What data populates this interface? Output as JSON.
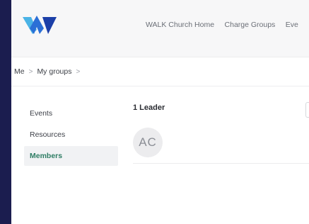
{
  "colors": {
    "background": "#1b1d4f",
    "accent": "#2e7d64",
    "logo_light": "#4ab3e6",
    "logo_dark": "#1c3fa8"
  },
  "logo": {
    "icon": "walk-church-logo"
  },
  "nav": {
    "items": [
      "WALK Church Home",
      "Charge Groups",
      "Eve"
    ]
  },
  "breadcrumb": {
    "items": [
      "Me",
      "My groups"
    ],
    "separator": ">"
  },
  "sidebar": {
    "items": [
      {
        "label": "Events",
        "active": false
      },
      {
        "label": "Resources",
        "active": false
      },
      {
        "label": "Members",
        "active": true
      }
    ]
  },
  "main": {
    "title": "1 Leader",
    "leader": {
      "initials": "AC"
    }
  }
}
